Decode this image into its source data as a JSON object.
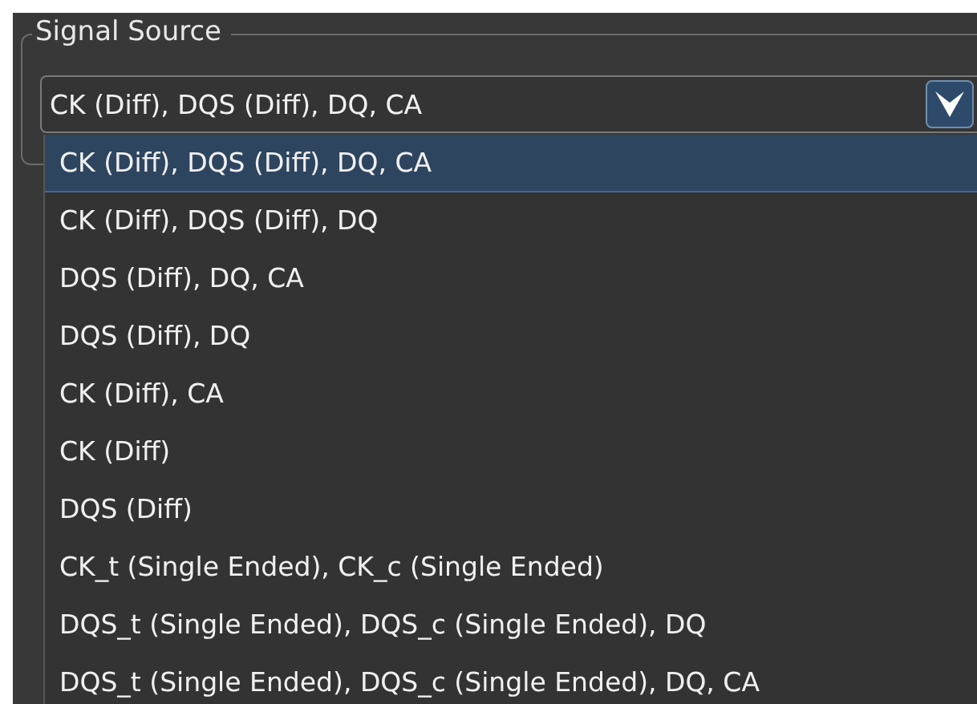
{
  "group": {
    "title": "Signal Source"
  },
  "combo": {
    "value": "CK (Diff), DQS (Diff), DQ, CA",
    "expanded": true
  },
  "options": [
    {
      "label": "CK (Diff), DQS (Diff), DQ, CA",
      "selected": true
    },
    {
      "label": "CK (Diff), DQS (Diff), DQ",
      "selected": false
    },
    {
      "label": "DQS (Diff), DQ, CA",
      "selected": false
    },
    {
      "label": "DQS (Diff), DQ",
      "selected": false
    },
    {
      "label": "CK (Diff), CA",
      "selected": false
    },
    {
      "label": "CK (Diff)",
      "selected": false
    },
    {
      "label": "DQS (Diff)",
      "selected": false
    },
    {
      "label": "CK_t (Single Ended), CK_c (Single Ended)",
      "selected": false
    },
    {
      "label": "DQS_t (Single Ended), DQS_c (Single Ended), DQ",
      "selected": false
    },
    {
      "label": "DQS_t (Single Ended), DQS_c (Single Ended), DQ, CA",
      "selected": false
    }
  ]
}
